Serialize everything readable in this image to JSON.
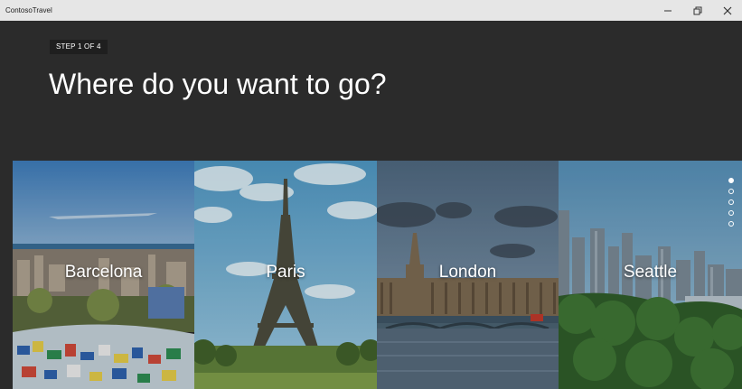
{
  "window": {
    "title": "ContosoTravel",
    "controls": [
      "minimize",
      "restore",
      "close"
    ]
  },
  "header": {
    "step": "STEP 1 OF 4",
    "title": "Where do you want to go?"
  },
  "destinations": [
    {
      "name": "Barcelona"
    },
    {
      "name": "Paris"
    },
    {
      "name": "London"
    },
    {
      "name": "Seattle"
    }
  ],
  "pager": {
    "count": 5,
    "active_index": 0
  },
  "colors": {
    "header_bg": "#2b2b2b",
    "titlebar_bg": "#e6e6e6",
    "text": "#ffffff"
  }
}
